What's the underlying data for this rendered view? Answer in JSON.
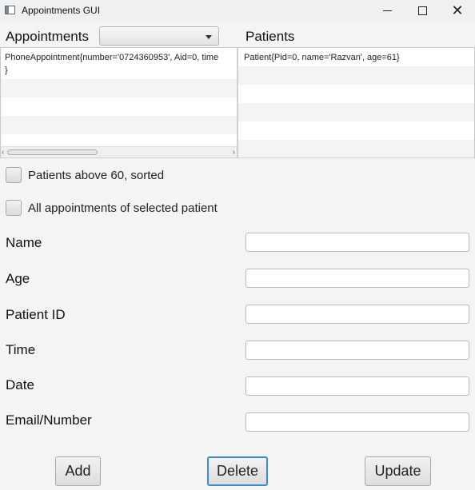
{
  "window": {
    "title": "Appointments GUI",
    "minimize": "─",
    "maximize": "☐",
    "close": "✕"
  },
  "appointments": {
    "label": "Appointments",
    "combo_value": "",
    "items": [
      "PhoneAppointment{number='0724360953', Aid=0, time\n}"
    ]
  },
  "patients": {
    "label": "Patients",
    "items": [
      "Patient{Pid=0, name='Razvan', age=61}"
    ]
  },
  "filters": {
    "above60": "Patients above 60, sorted",
    "allAppointments": "All appointments of selected patient"
  },
  "form": {
    "name": "Name",
    "age": "Age",
    "patientId": "Patient ID",
    "time": "Time",
    "date": "Date",
    "emailNumber": "Email/Number"
  },
  "buttons": {
    "add": "Add",
    "delete": "Delete",
    "update": "Update"
  }
}
